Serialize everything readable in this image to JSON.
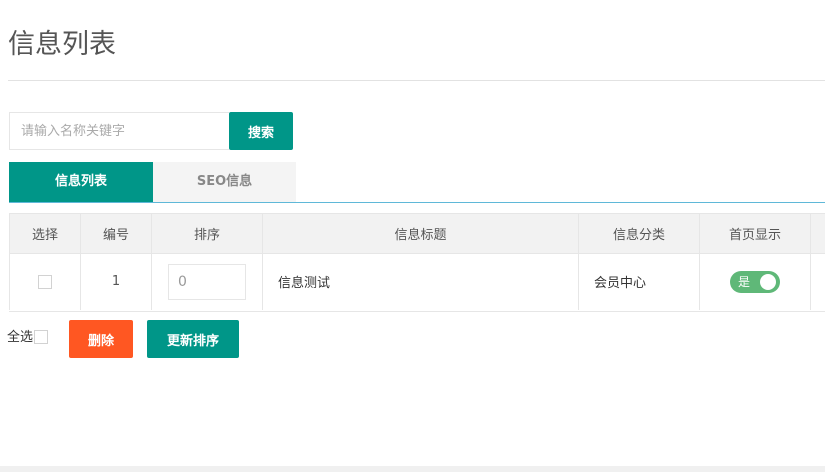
{
  "page": {
    "title": "信息列表"
  },
  "search": {
    "placeholder": "请输入名称关键字",
    "button_label": "搜索"
  },
  "tabs": [
    {
      "label": "信息列表",
      "active": true
    },
    {
      "label": "SEO信息",
      "active": false
    }
  ],
  "table": {
    "columns": [
      "选择",
      "编号",
      "排序",
      "信息标题",
      "信息分类",
      "首页显示"
    ],
    "rows": [
      {
        "selected": false,
        "id": "1",
        "sort": "0",
        "title": "信息测试",
        "category": "会员中心",
        "home_display": "是",
        "home_display_on": true
      }
    ]
  },
  "footer": {
    "select_all_label": "全选",
    "delete_label": "删除",
    "update_sort_label": "更新排序"
  },
  "colors": {
    "primary": "#009688",
    "danger": "#ff5722",
    "switch_on": "#5fb878"
  }
}
